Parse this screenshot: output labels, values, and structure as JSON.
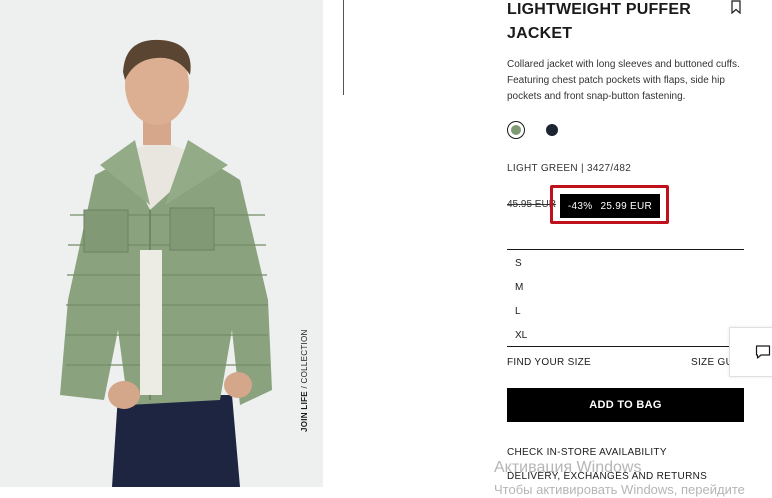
{
  "product": {
    "title": "LIGHTWEIGHT PUFFER JACKET",
    "description": "Collared jacket with long sleeves and buttoned cuffs. Featuring chest patch pockets with flaps, side hip pockets and front snap-button fastening.",
    "color_code": "LIGHT GREEN | 3427/482",
    "old_price": "45.95 EUR",
    "discount": "-43%",
    "price": "25.99 EUR",
    "colors": [
      {
        "name": "light-green",
        "hex": "#7f9a73",
        "selected": true
      },
      {
        "name": "navy",
        "hex": "#1c2433",
        "selected": false
      }
    ]
  },
  "photo": {
    "caption_bold": "JOIN LIFE",
    "caption_rest": " / COLLECTION"
  },
  "sizes": [
    "S",
    "M",
    "L",
    "XL"
  ],
  "actions": {
    "find_size": "FIND YOUR SIZE",
    "size_guide": "SIZE GUIDE",
    "add_to_bag": "ADD TO BAG",
    "check_store": "CHECK IN-STORE AVAILABILITY",
    "delivery": "DELIVERY, EXCHANGES AND RETURNS"
  },
  "icons": {
    "bookmark": "bookmark-icon",
    "chat": "chat-icon"
  },
  "watermark": {
    "line1": "Активация Windows",
    "line2": "Чтобы активировать Windows, перейдите"
  },
  "colors": {
    "highlight": "#c0101c",
    "button_bg": "#000000"
  }
}
